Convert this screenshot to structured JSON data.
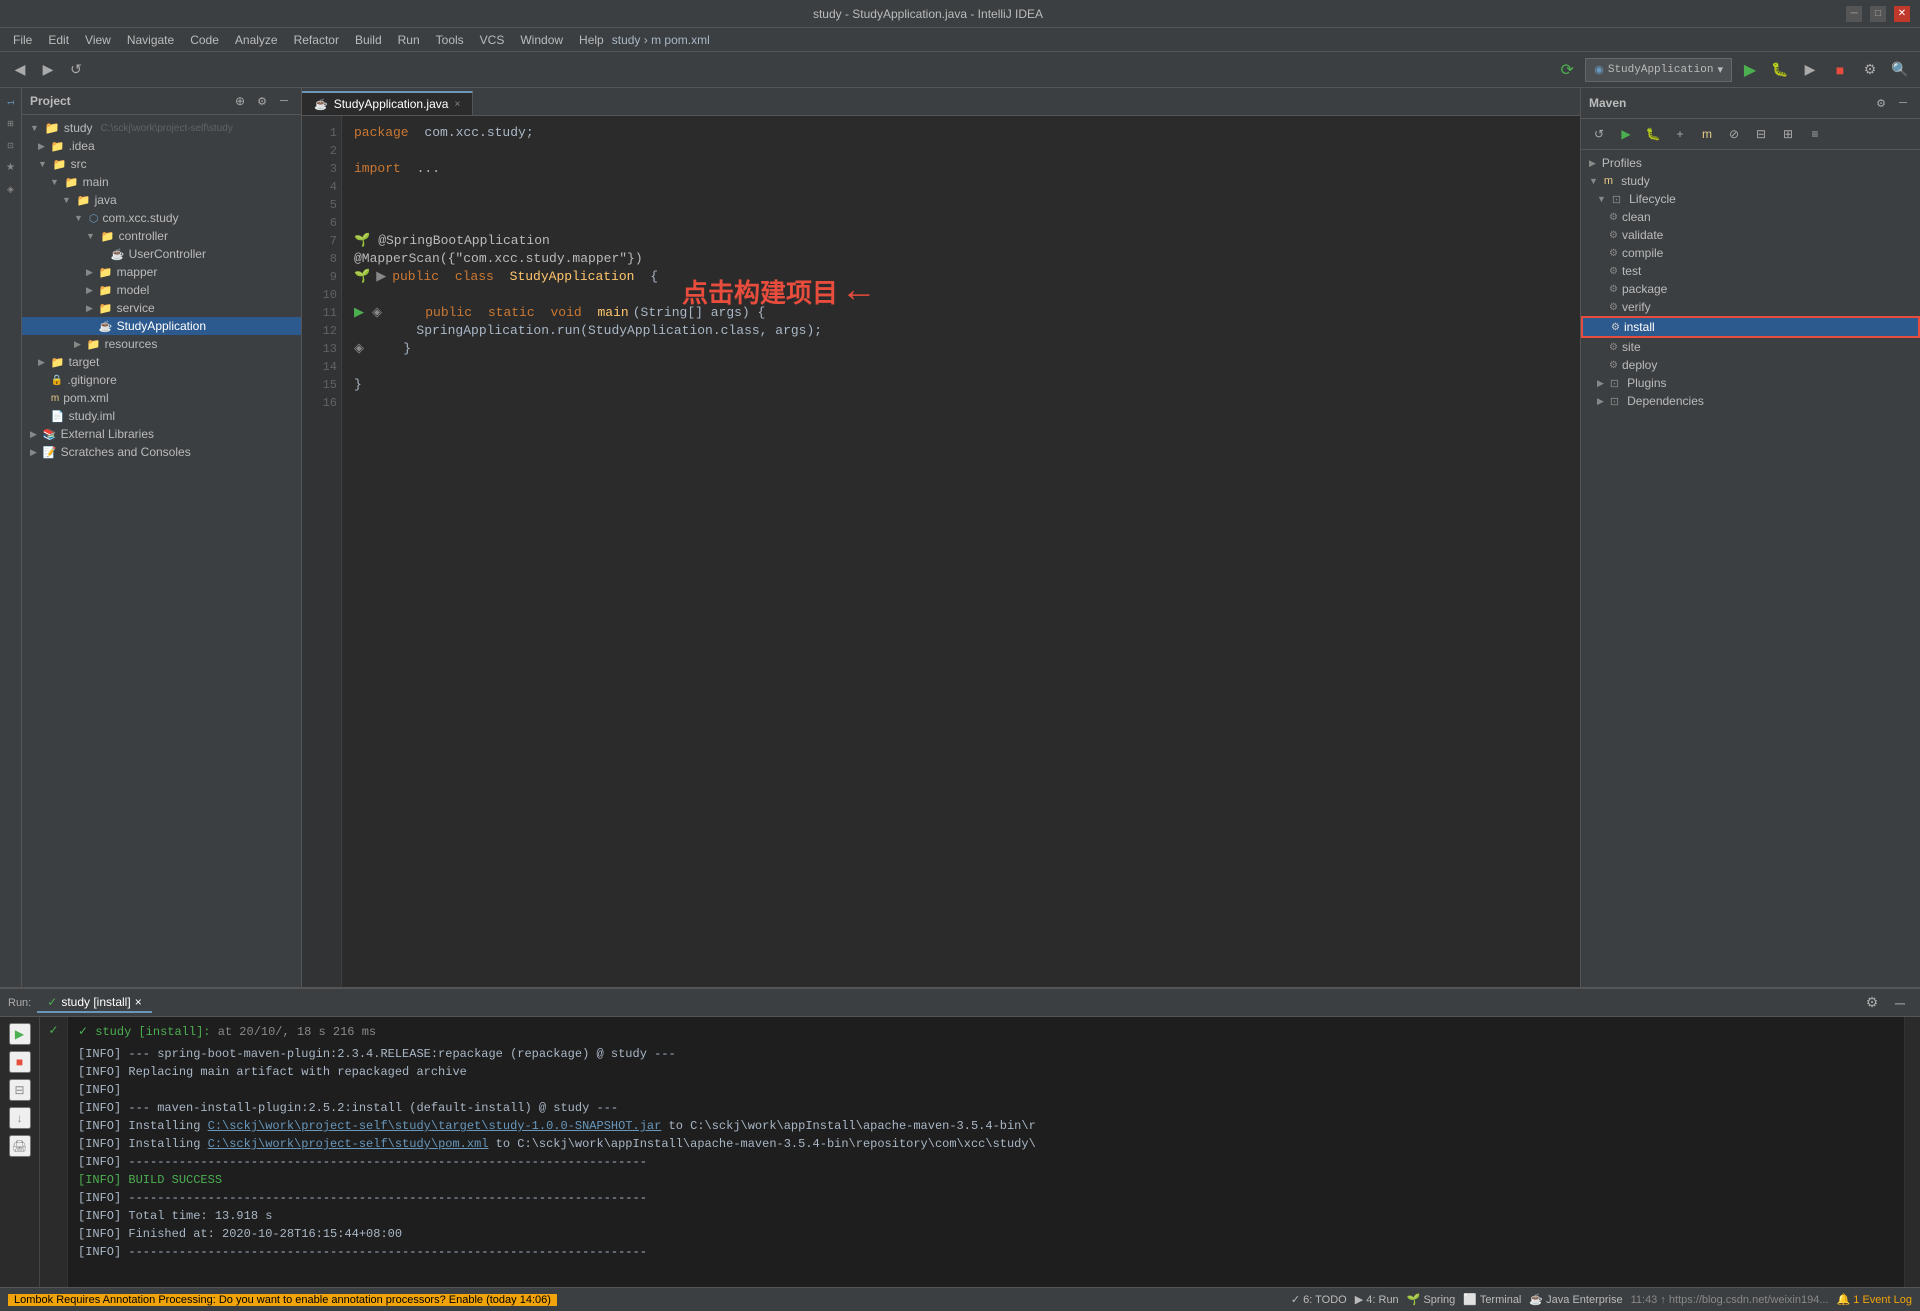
{
  "titleBar": {
    "title": "study - StudyApplication.java - IntelliJ IDEA",
    "minimize": "─",
    "maximize": "□",
    "close": "✕"
  },
  "menuBar": {
    "items": [
      "File",
      "Edit",
      "View",
      "Navigate",
      "Code",
      "Analyze",
      "Refactor",
      "Build",
      "Run",
      "Tools",
      "VCS",
      "Window",
      "Help"
    ],
    "breadcrumb": "study › m pom.xml"
  },
  "projectPanel": {
    "header": "Project",
    "items": [
      {
        "label": "study C:\\sckj\\work\\project-self\\study",
        "indent": 0,
        "type": "project",
        "expanded": true
      },
      {
        "label": ".idea",
        "indent": 1,
        "type": "folder",
        "expanded": false
      },
      {
        "label": "src",
        "indent": 1,
        "type": "folder",
        "expanded": true
      },
      {
        "label": "main",
        "indent": 2,
        "type": "folder",
        "expanded": true
      },
      {
        "label": "java",
        "indent": 3,
        "type": "folder",
        "expanded": true
      },
      {
        "label": "com.xcc.study",
        "indent": 4,
        "type": "package",
        "expanded": true
      },
      {
        "label": "controller",
        "indent": 5,
        "type": "folder",
        "expanded": true
      },
      {
        "label": "UserController",
        "indent": 6,
        "type": "java"
      },
      {
        "label": "mapper",
        "indent": 5,
        "type": "folder",
        "expanded": false
      },
      {
        "label": "model",
        "indent": 5,
        "type": "folder",
        "expanded": false
      },
      {
        "label": "service",
        "indent": 5,
        "type": "folder",
        "expanded": false
      },
      {
        "label": "StudyApplication",
        "indent": 5,
        "type": "java",
        "selected": true
      },
      {
        "label": "resources",
        "indent": 4,
        "type": "folder",
        "expanded": false
      },
      {
        "label": "target",
        "indent": 1,
        "type": "folder",
        "expanded": false
      },
      {
        "label": ".gitignore",
        "indent": 1,
        "type": "git"
      },
      {
        "label": "pom.xml",
        "indent": 1,
        "type": "xml"
      },
      {
        "label": "study.iml",
        "indent": 1,
        "type": "iml"
      },
      {
        "label": "External Libraries",
        "indent": 0,
        "type": "folder",
        "expanded": false
      },
      {
        "label": "Scratches and Consoles",
        "indent": 0,
        "type": "folder",
        "expanded": false
      }
    ]
  },
  "editorTab": {
    "label": "StudyApplication.java",
    "close": "×"
  },
  "codeLines": [
    {
      "num": "",
      "content": "package com.xcc.study;",
      "type": "normal"
    },
    {
      "num": "",
      "content": "",
      "type": "normal"
    },
    {
      "num": "",
      "content": "import ...",
      "type": "import"
    },
    {
      "num": "",
      "content": "",
      "type": "normal"
    },
    {
      "num": "",
      "content": "",
      "type": "normal"
    },
    {
      "num": "",
      "content": "",
      "type": "normal"
    },
    {
      "num": "7",
      "content": "@SpringBootApplication",
      "type": "annotation"
    },
    {
      "num": "8",
      "content": "@MapperScan({\"com.xcc.study.mapper\"})",
      "type": "annotation"
    },
    {
      "num": "9",
      "content": "public class StudyApplication {",
      "type": "class"
    },
    {
      "num": "10",
      "content": "",
      "type": "normal"
    },
    {
      "num": "11",
      "content": "    public static void main(String[] args) {",
      "type": "method"
    },
    {
      "num": "12",
      "content": "        SpringApplication.run(StudyApplication.class, args);",
      "type": "body"
    },
    {
      "num": "13",
      "content": "    }",
      "type": "normal"
    },
    {
      "num": "14",
      "content": "",
      "type": "normal"
    },
    {
      "num": "15",
      "content": "}",
      "type": "normal"
    },
    {
      "num": "16",
      "content": "",
      "type": "normal"
    }
  ],
  "mavenPanel": {
    "title": "Maven",
    "items": [
      {
        "label": "Profiles",
        "indent": 0,
        "type": "section"
      },
      {
        "label": "study",
        "indent": 0,
        "type": "module",
        "expanded": true
      },
      {
        "label": "Lifecycle",
        "indent": 1,
        "type": "section",
        "expanded": true
      },
      {
        "label": "clean",
        "indent": 2,
        "type": "lifecycle"
      },
      {
        "label": "validate",
        "indent": 2,
        "type": "lifecycle"
      },
      {
        "label": "compile",
        "indent": 2,
        "type": "lifecycle"
      },
      {
        "label": "test",
        "indent": 2,
        "type": "lifecycle"
      },
      {
        "label": "package",
        "indent": 2,
        "type": "lifecycle"
      },
      {
        "label": "verify",
        "indent": 2,
        "type": "lifecycle"
      },
      {
        "label": "install",
        "indent": 2,
        "type": "lifecycle",
        "highlighted": true
      },
      {
        "label": "site",
        "indent": 2,
        "type": "lifecycle"
      },
      {
        "label": "deploy",
        "indent": 2,
        "type": "lifecycle"
      },
      {
        "label": "Plugins",
        "indent": 1,
        "type": "section",
        "expanded": false
      },
      {
        "label": "Dependencies",
        "indent": 1,
        "type": "section",
        "expanded": false
      }
    ]
  },
  "annotation": {
    "text": "点击构建项目",
    "arrow": "←"
  },
  "runPanel": {
    "tabLabel": "Run:",
    "tabName": "study [install]",
    "closeBtn": "×",
    "runItem": "study [install]:",
    "runTime": "at 20/10/, 18 s 216 ms"
  },
  "consoleOutput": [
    "[INFO] --- spring-boot-maven-plugin:2.3.4.RELEASE:repackage (repackage) @ study ---",
    "[INFO] Replacing main artifact with repackaged archive",
    "[INFO]",
    "[INFO] --- maven-install-plugin:2.5.2:install (default-install) @ study ---",
    "[INFO] Installing C:\\sckj\\work\\project-self\\study\\target\\study-1.0.0-SNAPSHOT.jar to C:\\sckj\\work\\appInstall\\apache-maven-3.5.4-bin\\r",
    "[INFO] Installing C:\\sckj\\work\\project-self\\study\\pom.xml to C:\\sckj\\work\\appInstall\\apache-maven-3.5.4-bin\\repository\\com\\xcc\\study\\",
    "[INFO] ------------------------------------------------------------------------",
    "[INFO] BUILD SUCCESS",
    "[INFO] ------------------------------------------------------------------------",
    "[INFO] Total time: 13.918 s",
    "[INFO] Finished at: 2020-10-28T16:15:44+08:00",
    "[INFO] ------------------------------------------------------------------------"
  ],
  "statusBar": {
    "warning": "Lombok Requires Annotation Processing: Do you want to enable annotation processors? Enable (today 14:06)",
    "todo": "6: TODO",
    "run": "4: Run",
    "spring": "Spring",
    "terminal": "Terminal",
    "javaEnterprise": "Java Enterprise",
    "rightInfo": "11:43 ↑ https://blog.csdn.net/weixin194...",
    "eventLog": "1 Event Log"
  }
}
